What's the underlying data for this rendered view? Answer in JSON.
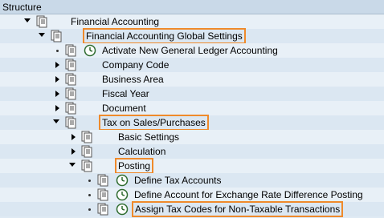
{
  "header": {
    "title": "Structure"
  },
  "rows": [
    {
      "label": "Financial Accounting"
    },
    {
      "label": "Financial Accounting Global Settings"
    },
    {
      "label": "Activate New General Ledger Accounting"
    },
    {
      "label": "Company Code"
    },
    {
      "label": "Business Area"
    },
    {
      "label": "Fiscal Year"
    },
    {
      "label": "Document"
    },
    {
      "label": "Tax on Sales/Purchases"
    },
    {
      "label": "Basic Settings"
    },
    {
      "label": "Calculation"
    },
    {
      "label": "Posting"
    },
    {
      "label": "Define Tax Accounts"
    },
    {
      "label": "Define Account for Exchange Rate Difference Posting"
    },
    {
      "label": "Assign Tax Codes for Non-Taxable Transactions"
    }
  ],
  "highlight_color": "#ef8a2b"
}
